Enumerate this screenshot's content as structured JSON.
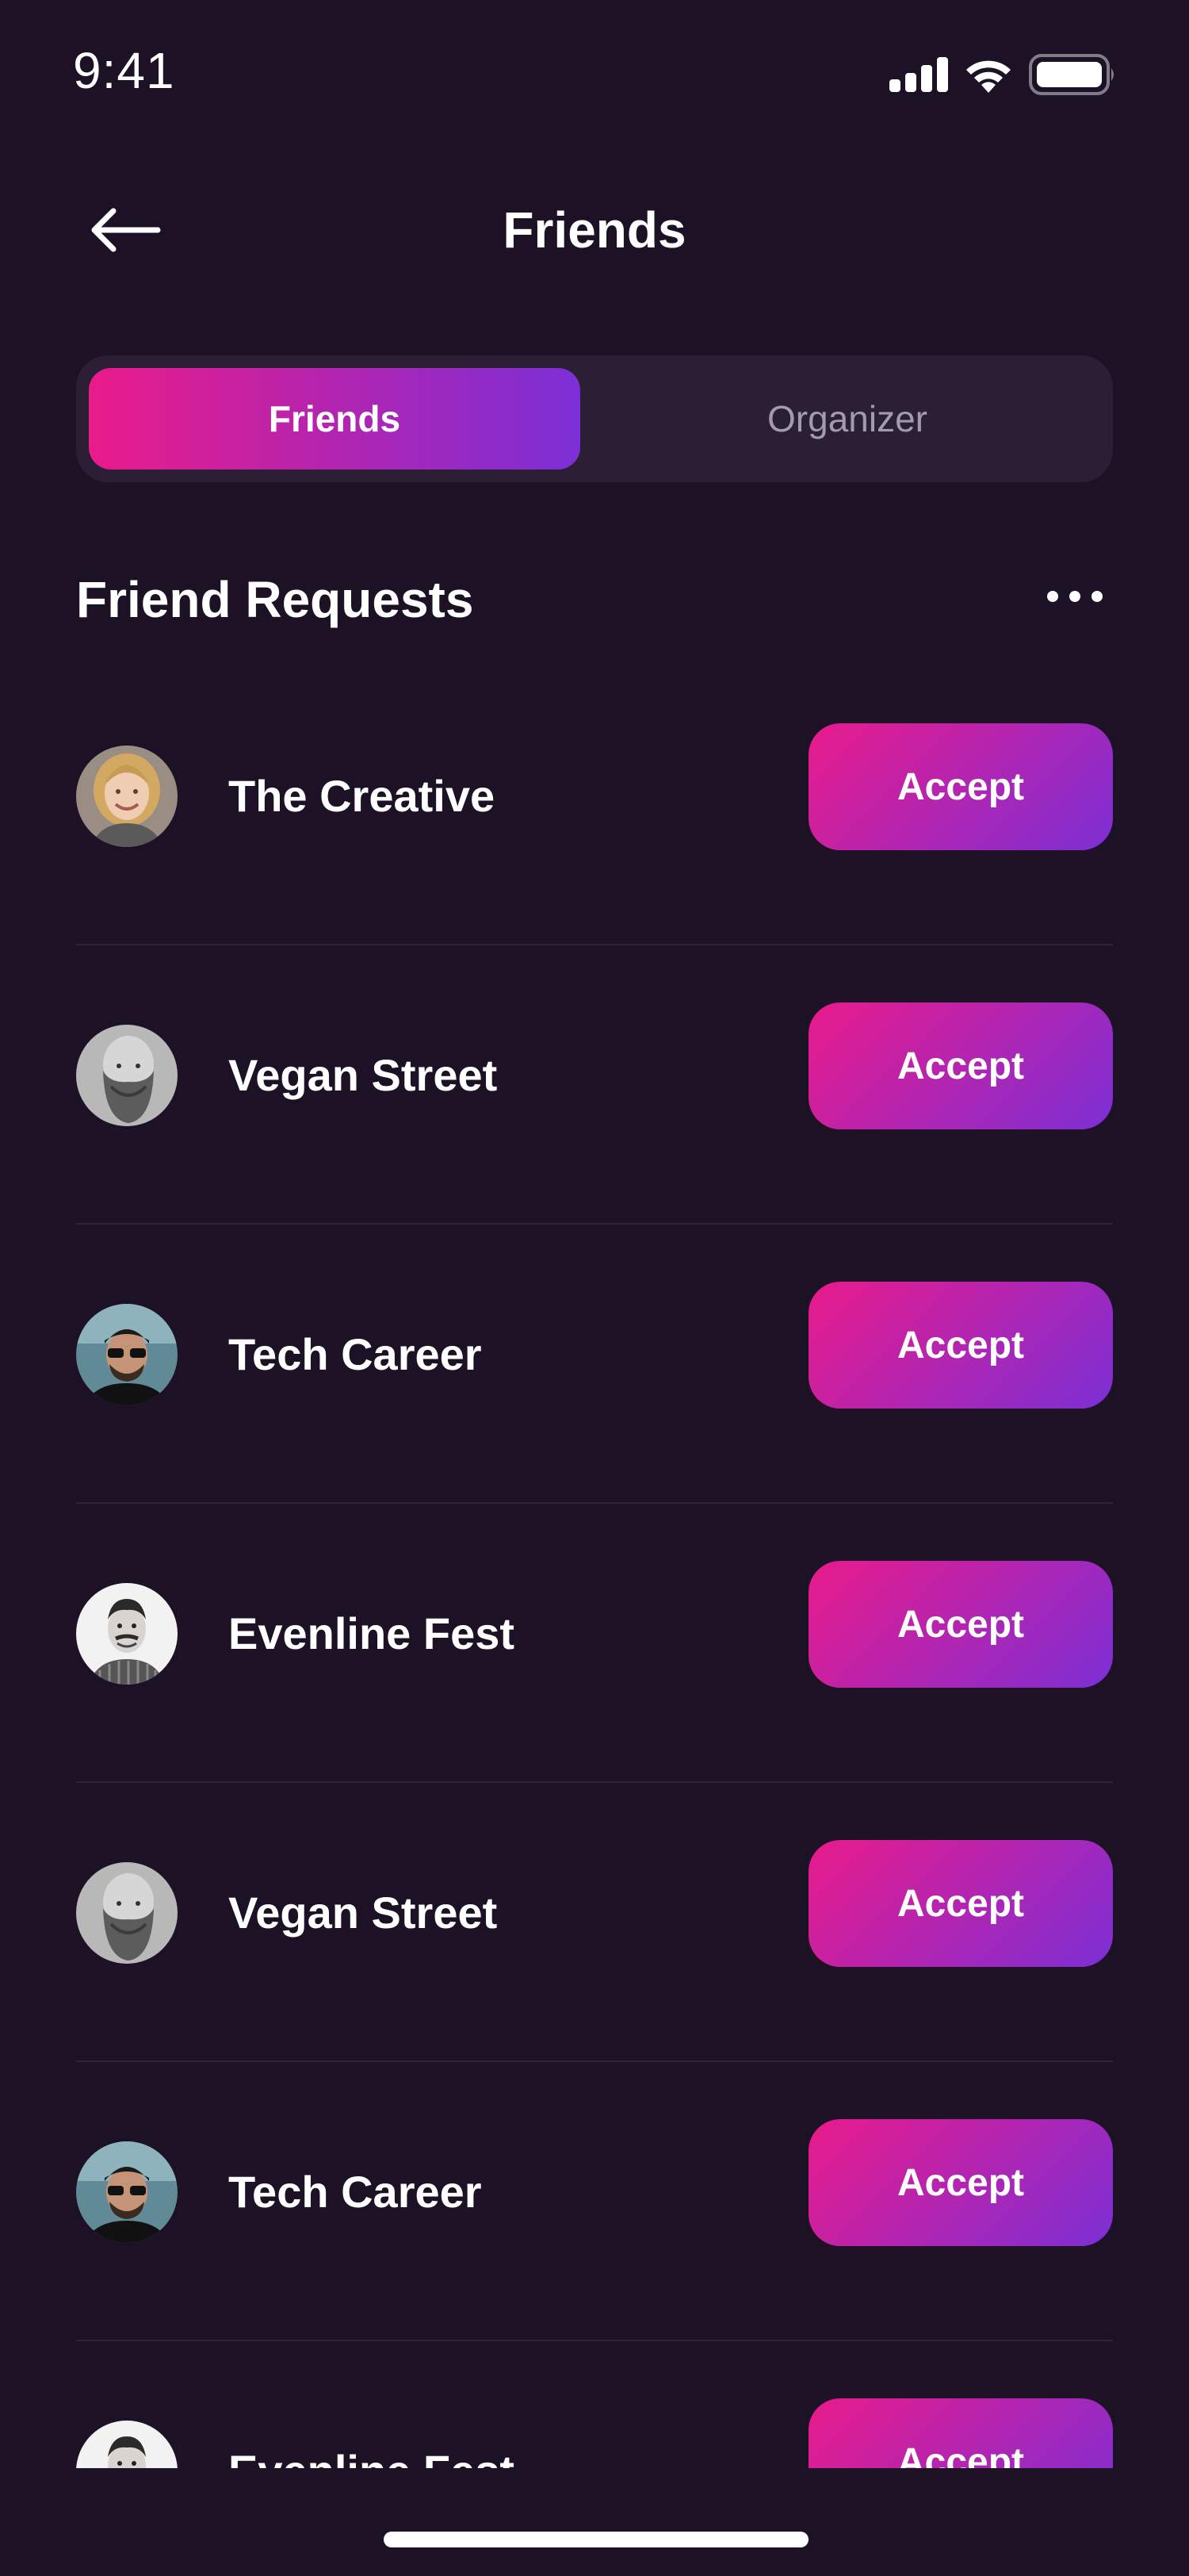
{
  "status_bar": {
    "time": "9:41",
    "icons": [
      "signal-icon",
      "wifi-icon",
      "battery-icon"
    ]
  },
  "header": {
    "title": "Friends",
    "back_icon": "arrow-left-icon"
  },
  "tabs": [
    {
      "label": "Friends",
      "active": true
    },
    {
      "label": "Organizer",
      "active": false
    }
  ],
  "section": {
    "title": "Friend Requests",
    "more_icon": "more-horizontal-icon"
  },
  "requests": [
    {
      "name": "The Creative",
      "action": "Accept",
      "avatar": "avatar-woman-blonde"
    },
    {
      "name": "Vegan Street",
      "action": "Accept",
      "avatar": "avatar-man-beard-grey"
    },
    {
      "name": "Tech Career",
      "action": "Accept",
      "avatar": "avatar-man-beanie-sunglasses"
    },
    {
      "name": "Evenline Fest",
      "action": "Accept",
      "avatar": "avatar-man-mustache-stripes"
    },
    {
      "name": "Vegan Street",
      "action": "Accept",
      "avatar": "avatar-man-beard-grey"
    },
    {
      "name": "Tech Career",
      "action": "Accept",
      "avatar": "avatar-man-beanie-sunglasses"
    },
    {
      "name": "Evenline Fest",
      "action": "Accept",
      "avatar": "avatar-man-mustache-stripes"
    }
  ],
  "colors": {
    "background": "#1d1225",
    "segment_bg": "#2a1f35",
    "gradient_start": "#ea1b8a",
    "gradient_end": "#7b2fd6",
    "divider": "#2e2438",
    "inactive_text": "#a39aae"
  }
}
